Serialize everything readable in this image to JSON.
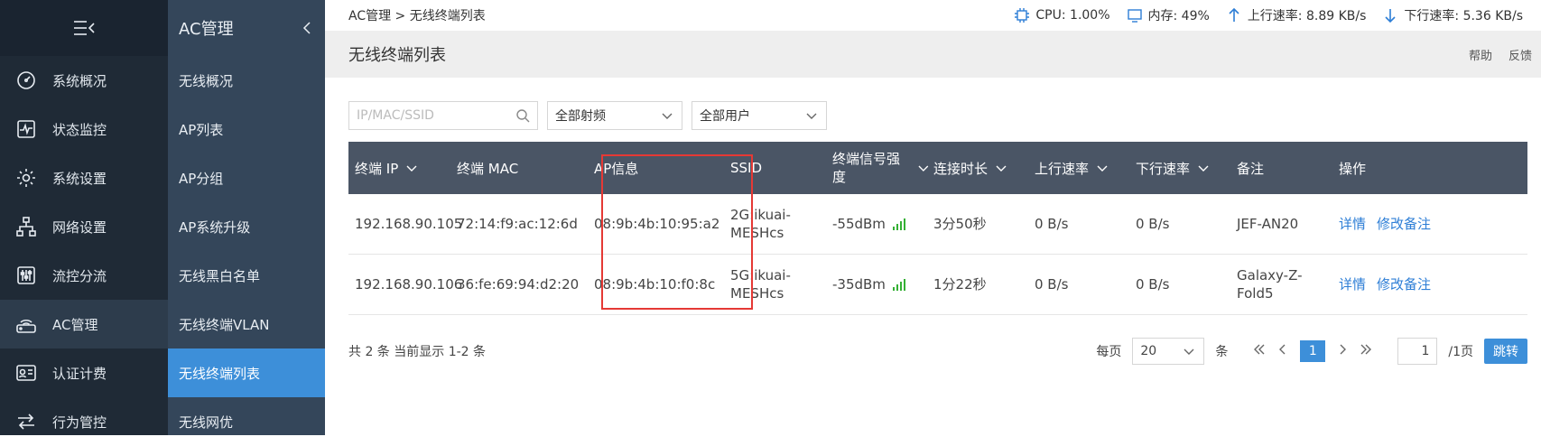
{
  "nav": {
    "items": [
      {
        "label": "系统概况",
        "icon": "gauge-icon"
      },
      {
        "label": "状态监控",
        "icon": "monitor-icon"
      },
      {
        "label": "系统设置",
        "icon": "gear-icon"
      },
      {
        "label": "网络设置",
        "icon": "network-icon"
      },
      {
        "label": "流控分流",
        "icon": "sliders-icon"
      },
      {
        "label": "AC管理",
        "icon": "wifi-router-icon"
      },
      {
        "label": "认证计费",
        "icon": "id-card-icon"
      },
      {
        "label": "行为管控",
        "icon": "arrows-icon"
      }
    ]
  },
  "submenu": {
    "title": "AC管理",
    "items": [
      "无线概况",
      "AP列表",
      "AP分组",
      "AP系统升级",
      "无线黑白名单",
      "无线终端VLAN",
      "无线终端列表",
      "无线网优"
    ]
  },
  "topbar": {
    "breadcrumb": "AC管理 > 无线终端列表",
    "cpu": "CPU: 1.00%",
    "mem": "内存: 49%",
    "up": "上行速率: 8.89 KB/s",
    "down": "下行速率: 5.36 KB/s"
  },
  "page": {
    "title": "无线终端列表",
    "help": "帮助",
    "feedback": "反馈"
  },
  "filters": {
    "search_placeholder": "IP/MAC/SSID",
    "band": "全部射频",
    "user": "全部用户"
  },
  "table": {
    "headers": {
      "ip": "终端 IP",
      "mac": "终端 MAC",
      "ap": "AP信息",
      "ssid": "SSID",
      "signal": "终端信号强度",
      "duration": "连接时长",
      "up": "上行速率",
      "down": "下行速率",
      "note": "备注",
      "ops": "操作"
    },
    "rows": [
      {
        "ip": "192.168.90.105",
        "mac": "72:14:f9:ac:12:6d",
        "ap": "08:9b:4b:10:95:a2",
        "ssid": "2G:ikuai-MESHcs",
        "signal": "-55dBm",
        "duration": "3分50秒",
        "up": "0 B/s",
        "down": "0 B/s",
        "note": "JEF-AN20",
        "detail": "详情",
        "edit": "修改备注"
      },
      {
        "ip": "192.168.90.106",
        "mac": "36:fe:69:94:d2:20",
        "ap": "08:9b:4b:10:f0:8c",
        "ssid": "5G:ikuai-MESHcs",
        "signal": "-35dBm",
        "duration": "1分22秒",
        "up": "0 B/s",
        "down": "0 B/s",
        "note": "Galaxy-Z-Fold5",
        "detail": "详情",
        "edit": "修改备注"
      }
    ]
  },
  "footer": {
    "total": "共 2 条 当前显示 1-2 条",
    "per_page_label": "每页",
    "per_page": "20",
    "unit": "条",
    "current_page": "1",
    "page_input": "1",
    "total_pages": "/1页",
    "jump": "跳转"
  },
  "colors": {
    "accent": "#3d8fd9",
    "nav_bg": "#1f2a36",
    "sub_bg": "#34465a",
    "table_head": "#4a5565",
    "highlight": "#e53935",
    "signal": "#34b034"
  }
}
